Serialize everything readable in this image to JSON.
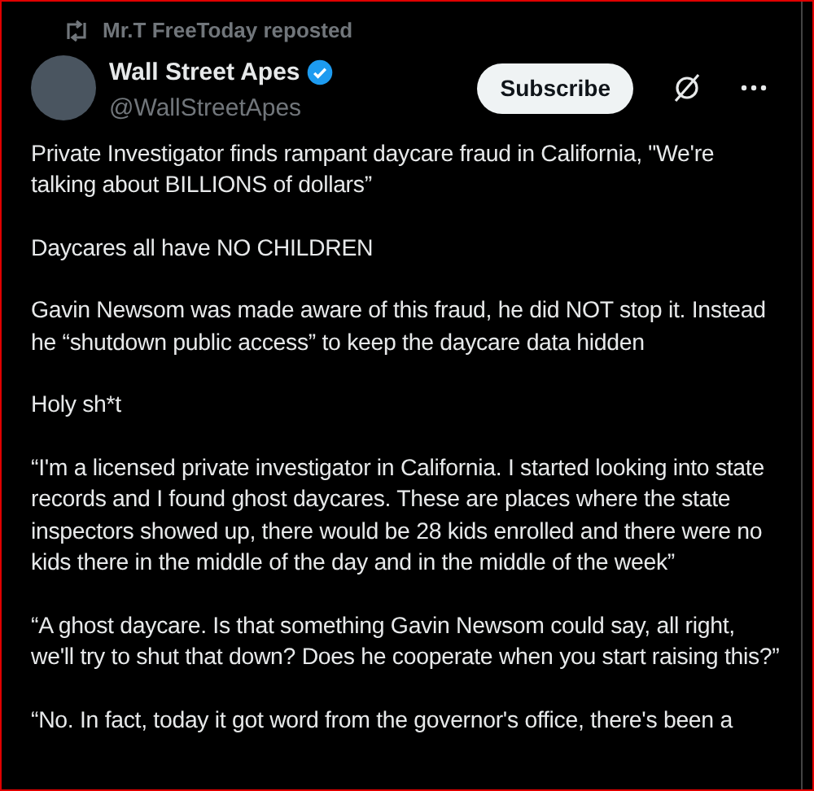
{
  "repost": {
    "text": "Mr.T FreeToday reposted"
  },
  "author": {
    "name": "Wall Street Apes",
    "verified": true,
    "handle": "@WallStreetApes"
  },
  "subscribe_button": "Subscribe",
  "paragraphs": [
    "Private Investigator finds rampant daycare fraud in California, \"We're talking about BILLIONS of dollars”",
    "Daycares all have NO CHILDREN",
    "Gavin Newsom was made aware of this fraud, he did NOT stop it. Instead he “shutdown public access” to keep the daycare data hidden",
    "Holy sh*t",
    "“I'm a licensed private investigator in California. I started looking into state records and I found ghost daycares. These are places where the state inspectors showed up, there would be 28 kids enrolled and there were no kids there in the middle of the day and in the middle of the week”",
    "“A ghost daycare. Is that something Gavin Newsom could say, all right, we'll try to shut that down? Does he cooperate when you start raising this?”",
    "“No. In fact, today it got word from the governor's office, there's been a"
  ]
}
